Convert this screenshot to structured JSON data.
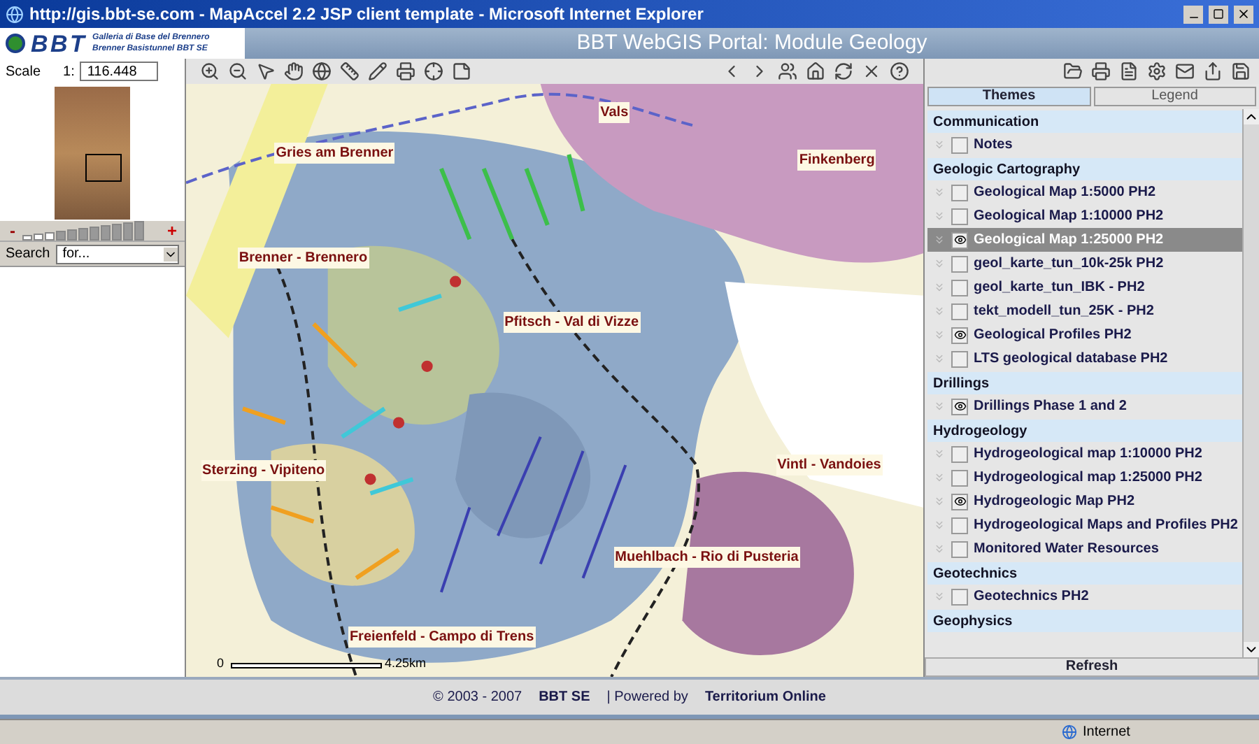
{
  "window": {
    "title": "http://gis.bbt-se.com - MapAccel 2.2 JSP client template - Microsoft Internet Explorer"
  },
  "header": {
    "logo_text": "BBT",
    "logo_lines": [
      "Galleria di Base del Brennero",
      "Brenner Basistunnel BBT SE"
    ],
    "title": "BBT WebGIS Portal: Module Geology"
  },
  "scale": {
    "label": "Scale",
    "prefix": "1:",
    "value": "116.448"
  },
  "zoom_slider": {
    "minus": "-",
    "plus": "+",
    "level": 0.27
  },
  "search": {
    "label": "Search",
    "value": "for..."
  },
  "map": {
    "labels": [
      {
        "text": "Vals"
      },
      {
        "text": "Gries am Brenner"
      },
      {
        "text": "Finkenberg"
      },
      {
        "text": "Brenner - Brennero"
      },
      {
        "text": "Pfitsch - Val di Vizze"
      },
      {
        "text": "Sterzing - Vipiteno"
      },
      {
        "text": "Vintl - Vandoies"
      },
      {
        "text": "Muehlbach - Rio di Pusteria"
      },
      {
        "text": "Freienfeld - Campo di Trens"
      }
    ],
    "scale_bar": {
      "start": "0",
      "end": "4.25km"
    }
  },
  "themes_panel": {
    "tabs": [
      {
        "label": "Themes",
        "selected": true
      },
      {
        "label": "Legend",
        "selected": false
      }
    ],
    "items": [
      {
        "kind": "group",
        "label": "Communication"
      },
      {
        "kind": "layer",
        "label": "Notes",
        "checked": false,
        "selected": false
      },
      {
        "kind": "group",
        "label": "Geologic Cartography"
      },
      {
        "kind": "layer",
        "label": "Geological Map 1:5000 PH2",
        "checked": false,
        "selected": false
      },
      {
        "kind": "layer",
        "label": "Geological Map 1:10000 PH2",
        "checked": false,
        "selected": false
      },
      {
        "kind": "layer",
        "label": "Geological Map 1:25000 PH2",
        "checked": true,
        "selected": true
      },
      {
        "kind": "layer",
        "label": "geol_karte_tun_10k-25k PH2",
        "checked": false,
        "selected": false
      },
      {
        "kind": "layer",
        "label": "geol_karte_tun_IBK - PH2",
        "checked": false,
        "selected": false
      },
      {
        "kind": "layer",
        "label": "tekt_modell_tun_25K - PH2",
        "checked": false,
        "selected": false
      },
      {
        "kind": "layer",
        "label": "Geological Profiles PH2",
        "checked": true,
        "selected": false
      },
      {
        "kind": "layer",
        "label": "LTS geological database PH2",
        "checked": false,
        "selected": false
      },
      {
        "kind": "group",
        "label": "Drillings"
      },
      {
        "kind": "layer",
        "label": "Drillings Phase 1 and 2",
        "checked": true,
        "selected": false
      },
      {
        "kind": "group",
        "label": "Hydrogeology"
      },
      {
        "kind": "layer",
        "label": "Hydrogeological map 1:10000 PH2",
        "checked": false,
        "selected": false
      },
      {
        "kind": "layer",
        "label": "Hydrogeological map 1:25000 PH2",
        "checked": false,
        "selected": false
      },
      {
        "kind": "layer",
        "label": "Hydrogeologic Map PH2",
        "checked": true,
        "selected": false
      },
      {
        "kind": "layer",
        "label": "Hydrogeological Maps and Profiles PH2",
        "checked": false,
        "selected": false
      },
      {
        "kind": "layer",
        "label": "Monitored Water Resources",
        "checked": false,
        "selected": false
      },
      {
        "kind": "group",
        "label": "Geotechnics"
      },
      {
        "kind": "layer",
        "label": "Geotechnics PH2",
        "checked": false,
        "selected": false
      },
      {
        "kind": "group",
        "label": "Geophysics"
      }
    ],
    "refresh": "Refresh"
  },
  "footer": {
    "copyright": "© 2003 - 2007",
    "company": "BBT SE",
    "powered_by": "| Powered by",
    "product": "Territorium Online"
  },
  "status_bar": {
    "zone": "Internet"
  }
}
